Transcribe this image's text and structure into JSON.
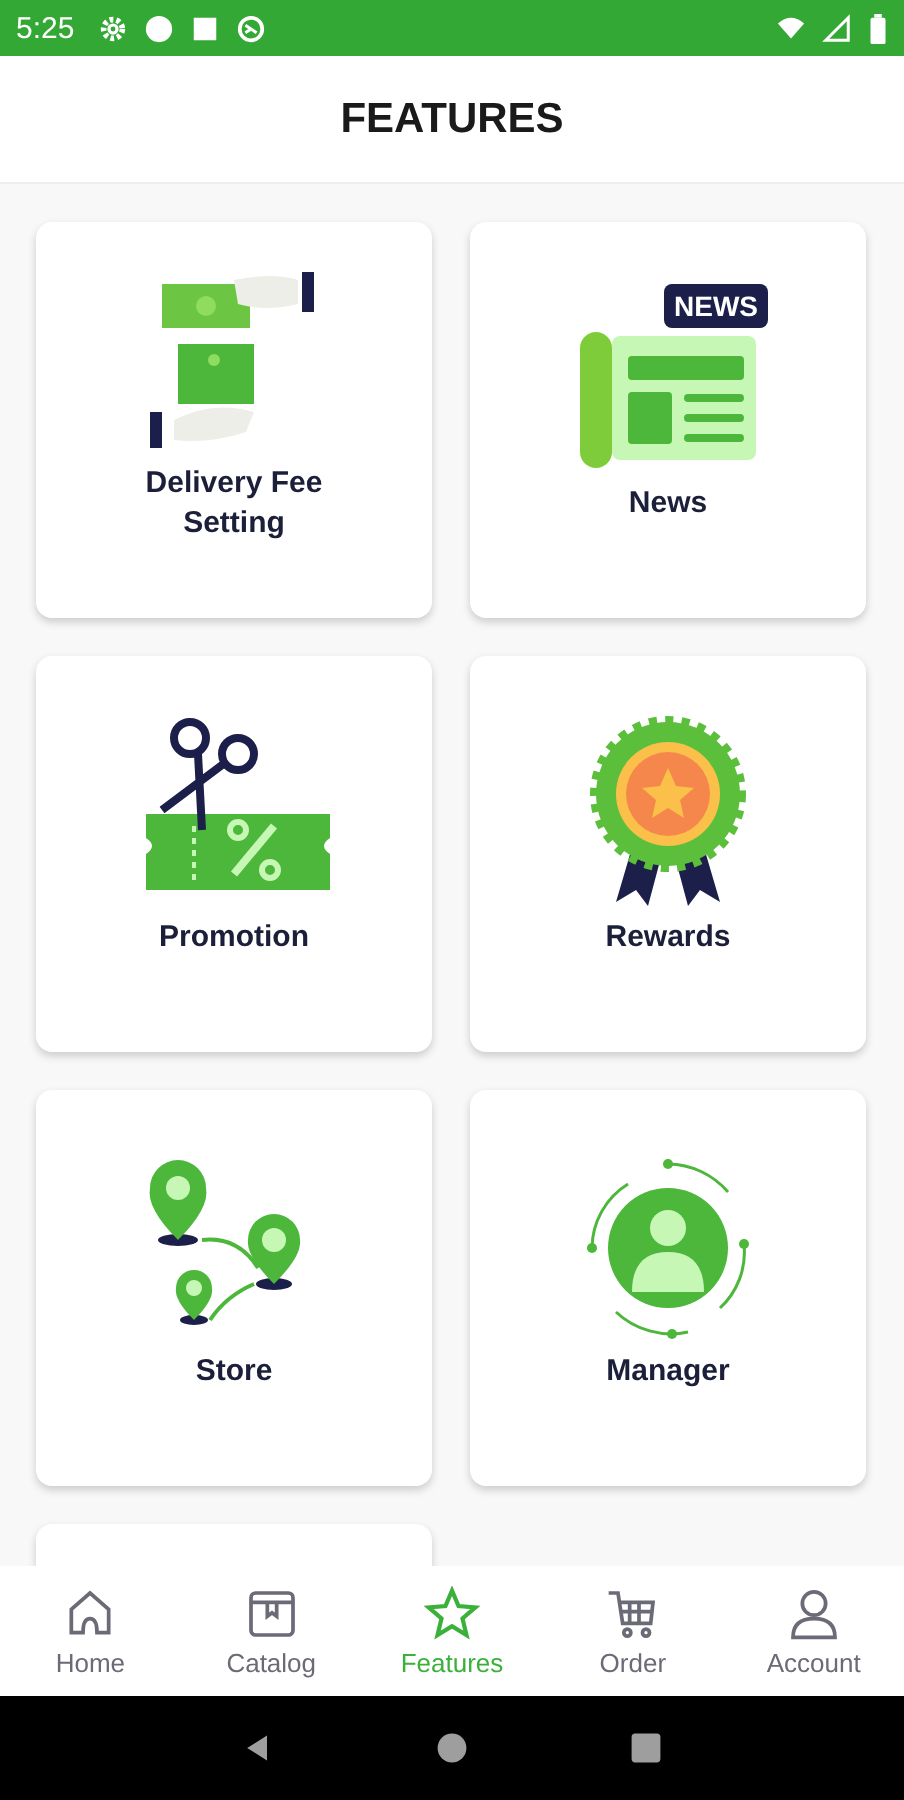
{
  "status_bar": {
    "time": "5:25"
  },
  "header": {
    "title": "FEATURES"
  },
  "features": [
    {
      "label": "Delivery Fee\nSetting",
      "kind": "money"
    },
    {
      "label": "News",
      "kind": "news",
      "badge": "NEWS"
    },
    {
      "label": "Promotion",
      "kind": "coupon"
    },
    {
      "label": "Rewards",
      "kind": "medal"
    },
    {
      "label": "Store",
      "kind": "pins"
    },
    {
      "label": "Manager",
      "kind": "person"
    },
    {
      "kind": "partial"
    }
  ],
  "bottom_nav": [
    {
      "label": "Home",
      "kind": "home",
      "selected": false
    },
    {
      "label": "Catalog",
      "kind": "box",
      "selected": false
    },
    {
      "label": "Features",
      "kind": "star",
      "selected": true
    },
    {
      "label": "Order",
      "kind": "cart",
      "selected": false
    },
    {
      "label": "Account",
      "kind": "user",
      "selected": false
    }
  ]
}
